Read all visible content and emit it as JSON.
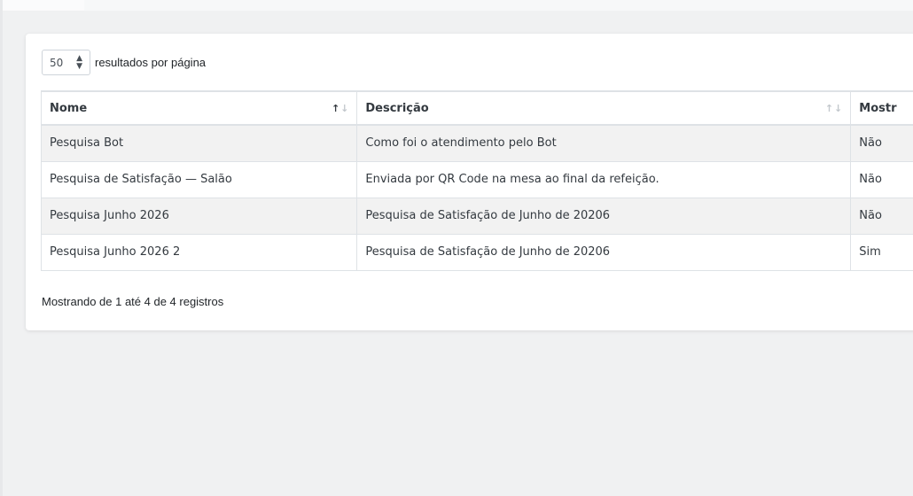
{
  "length_menu": {
    "selected": "50",
    "suffix": "resultados por página"
  },
  "table": {
    "columns": [
      {
        "label": "Nome",
        "sort": "ascending"
      },
      {
        "label": "Descrição",
        "sort": "none"
      },
      {
        "label": "Mostr",
        "sort": "none"
      }
    ],
    "rows": [
      {
        "nome": "Pesquisa Bot",
        "descricao": "Como foi o atendimento pelo Bot",
        "mostrar": "Não"
      },
      {
        "nome": "Pesquisa de Satisfação — Salão",
        "descricao": "Enviada por QR Code na mesa ao final da refeição.",
        "mostrar": "Não"
      },
      {
        "nome": "Pesquisa Junho 2026",
        "descricao": "Pesquisa de Satisfação de Junho de 20206",
        "mostrar": "Não"
      },
      {
        "nome": "Pesquisa Junho 2026 2",
        "descricao": "Pesquisa de Satisfação de Junho de 20206",
        "mostrar": "Sim"
      }
    ]
  },
  "info_text": "Mostrando de 1 até 4 de 4 registros",
  "icons": {
    "select_caret": "up-down-caret-icon",
    "sort": "sort-arrows-icon"
  },
  "colors": {
    "page_bg": "#f0f1f2",
    "card_bg": "#ffffff",
    "stripe": "#f2f2f2",
    "border": "#dee2e6",
    "text": "#343a40"
  }
}
